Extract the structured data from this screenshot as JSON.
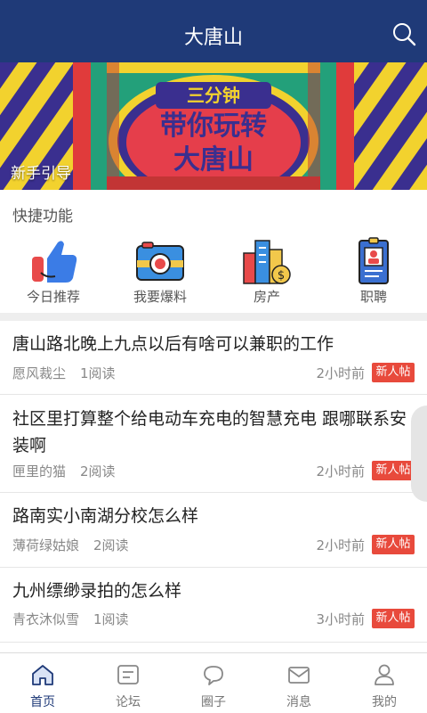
{
  "header": {
    "title": "大唐山",
    "search_icon": "search-icon",
    "background": "#1f3a78"
  },
  "banner": {
    "line1": "三分钟",
    "line2": "带你玩转",
    "line3": "大唐山",
    "caption": "新手引导"
  },
  "quick": {
    "title": "快捷功能",
    "items": [
      {
        "label": "今日推荐",
        "icon": "thumbs-up-icon"
      },
      {
        "label": "我要爆料",
        "icon": "camera-icon"
      },
      {
        "label": "房产",
        "icon": "buildings-icon"
      },
      {
        "label": "职聘",
        "icon": "id-badge-icon"
      }
    ]
  },
  "posts": [
    {
      "title": "唐山路北晚上九点以后有啥可以兼职的工作",
      "author": "愿风裁尘",
      "reads": "1阅读",
      "time": "2小时前",
      "tag": "新人帖"
    },
    {
      "title": "社区里打算整个给电动车充电的智慧充电 跟哪联系安装啊",
      "author": "匣里的猫",
      "reads": "2阅读",
      "time": "2小时前",
      "tag": "新人帖"
    },
    {
      "title": "路南实小南湖分校怎么样",
      "author": "薄荷绿姑娘",
      "reads": "2阅读",
      "time": "2小时前",
      "tag": "新人帖"
    },
    {
      "title": "九州缥缈录拍的怎么样",
      "author": "青衣沐似雪",
      "reads": "1阅读",
      "time": "3小时前",
      "tag": "新人帖"
    }
  ],
  "tabs": [
    {
      "label": "首页",
      "icon": "home-icon",
      "active": true
    },
    {
      "label": "论坛",
      "icon": "forum-icon",
      "active": false
    },
    {
      "label": "圈子",
      "icon": "chat-bubble-icon",
      "active": false
    },
    {
      "label": "消息",
      "icon": "mail-icon",
      "active": false
    },
    {
      "label": "我的",
      "icon": "user-icon",
      "active": false
    }
  ],
  "colors": {
    "accent": "#1f3a78",
    "tag": "#e84a3c",
    "active_tab": "#1f3a78"
  }
}
